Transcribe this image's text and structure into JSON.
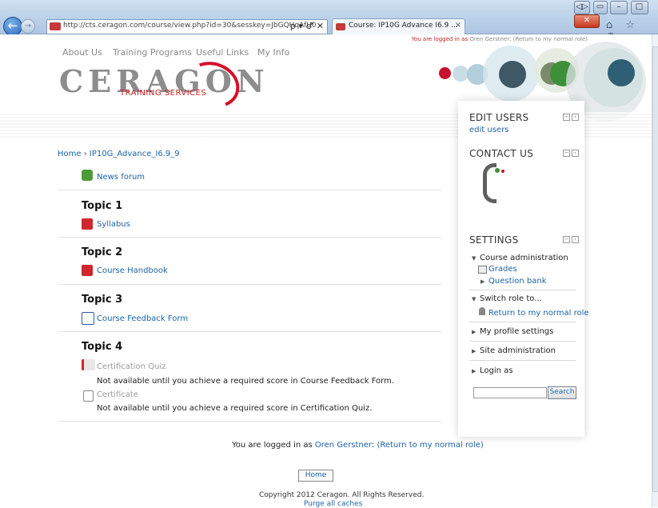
{
  "browser": {
    "url": "http://cts.ceragon.com/course/view.php?id=30&sesskey=JbGQHqAfU0",
    "address_controls": "ρ ▾ ♂ ✕",
    "tab_title": "Course: IP10G Advance I6.9 ...",
    "tab_close": "×",
    "window_buttons": [
      "◁▷",
      "▭",
      "–",
      "□",
      "✕"
    ],
    "tools_icons": "⌂ ☆ ⚙"
  },
  "login_bar": {
    "prefix": "You are logged in as",
    "user": "Oren Gerstner",
    "return": "(Return to my normal role)"
  },
  "top_nav": [
    "About Us",
    "Training Programs",
    "Useful Links",
    "My Info"
  ],
  "logo": {
    "brand": "CERAGON",
    "sub": "TRAINING SERVICES"
  },
  "breadcrumb": {
    "home": "Home",
    "sep": "›",
    "course": "IP10G_Advance_I6.9_9"
  },
  "intro": {
    "news_forum": "News forum"
  },
  "topics": [
    {
      "title": "Topic 1",
      "activity": "Syllabus"
    },
    {
      "title": "Topic 2",
      "activity": "Course Handbook"
    },
    {
      "title": "Topic 3",
      "activity": "Course Feedback Form"
    },
    {
      "title": "Topic 4",
      "activity": "Certification Quiz",
      "restriction1": "Not available until you achieve a required score in Course Feedback Form.",
      "activity2": "Certificate",
      "restriction2": "Not available until you achieve a required score in Certification Quiz."
    }
  ],
  "blocks": {
    "edit_users": {
      "title": "EDIT USERS",
      "link": "edit users"
    },
    "contact_us": {
      "title": "CONTACT US"
    },
    "settings": {
      "title": "SETTINGS",
      "course_admin": "Course administration",
      "grades": "Grades",
      "question_bank": "Question bank",
      "switch_role": "Switch role to...",
      "return_normal": "Return to my normal role",
      "my_profile": "My profile settings",
      "site_admin": "Site administration",
      "login_as": "Login as"
    },
    "search_button": "Search",
    "block_ctrl_a": "−",
    "block_ctrl_b": "‹"
  },
  "footer": {
    "login_prefix": "You are logged in as",
    "user": "Oren Gerstner",
    "return": "(Return to my normal role)",
    "home": "Home",
    "copyright": "Copyright 2012 Ceragon. All Rights Reserved.",
    "purge": "Purge all caches"
  },
  "colors": {
    "accent_red": "#c61e1e",
    "link_blue": "#1c63a8",
    "deco_green_dark": "#3f8a3c",
    "deco_slate": "#2f5f6e"
  }
}
